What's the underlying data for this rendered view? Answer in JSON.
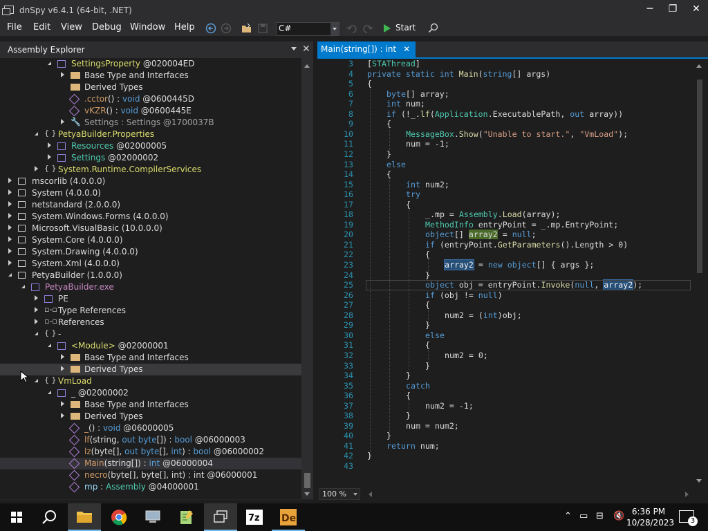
{
  "window": {
    "title": "dnSpy v6.4.1 (64-bit, .NET)"
  },
  "menu": [
    "File",
    "Edit",
    "View",
    "Debug",
    "Window",
    "Help"
  ],
  "toolbar": {
    "language": "C#",
    "start_label": "Start"
  },
  "explorer": {
    "title": "Assembly Explorer",
    "rows": [
      {
        "d": 3,
        "exp": "ef",
        "ico": "cls",
        "parts": [
          [
            "SettingsProperty",
            "cy"
          ],
          [
            " @020004ED",
            "cw"
          ]
        ]
      },
      {
        "d": 4,
        "exp": "c",
        "ico": "folder",
        "parts": [
          [
            "Base Type and Interfaces",
            "cw"
          ]
        ]
      },
      {
        "d": 4,
        "exp": "",
        "ico": "folder",
        "parts": [
          [
            "Derived Types",
            "cw"
          ]
        ]
      },
      {
        "d": 4,
        "exp": "",
        "ico": "meth",
        "parts": [
          [
            ".cctor",
            "co"
          ],
          [
            "() : ",
            "cw"
          ],
          [
            "void",
            "cb"
          ],
          [
            " @0600445D",
            "cw"
          ]
        ]
      },
      {
        "d": 4,
        "exp": "",
        "ico": "meth",
        "parts": [
          [
            "vKZR",
            "co"
          ],
          [
            "() : ",
            "cw"
          ],
          [
            "void",
            "cb"
          ],
          [
            " @0600445E",
            "cw"
          ]
        ]
      },
      {
        "d": 4,
        "exp": "c",
        "ico": "prop",
        "parts": [
          [
            "Settings",
            "cgr"
          ],
          [
            " : ",
            "cgr"
          ],
          [
            "Settings",
            "cgr"
          ],
          [
            " @1700037B",
            "cgr"
          ]
        ]
      },
      {
        "d": 2,
        "exp": "ef",
        "ico": "ns",
        "parts": [
          [
            "PetyaBuilder.Properties",
            "cy"
          ]
        ]
      },
      {
        "d": 3,
        "exp": "c",
        "ico": "cls",
        "parts": [
          [
            "Resources",
            "cc"
          ],
          [
            " @02000005",
            "cw"
          ]
        ]
      },
      {
        "d": 3,
        "exp": "c",
        "ico": "cls",
        "parts": [
          [
            "Settings",
            "cc"
          ],
          [
            " @02000002",
            "cw"
          ]
        ]
      },
      {
        "d": 2,
        "exp": "c",
        "ico": "ns",
        "parts": [
          [
            "System.Runtime.CompilerServices",
            "cy"
          ]
        ]
      },
      {
        "d": 0,
        "exp": "c",
        "ico": "asm",
        "parts": [
          [
            "mscorlib (4.0.0.0)",
            "cw"
          ]
        ]
      },
      {
        "d": 0,
        "exp": "c",
        "ico": "asm",
        "parts": [
          [
            "System (4.0.0.0)",
            "cw"
          ]
        ]
      },
      {
        "d": 0,
        "exp": "c",
        "ico": "asm",
        "parts": [
          [
            "netstandard (2.0.0.0)",
            "cw"
          ]
        ]
      },
      {
        "d": 0,
        "exp": "c",
        "ico": "asm",
        "parts": [
          [
            "System.Windows.Forms (4.0.0.0)",
            "cw"
          ]
        ]
      },
      {
        "d": 0,
        "exp": "c",
        "ico": "asm",
        "parts": [
          [
            "Microsoft.VisualBasic (10.0.0.0)",
            "cw"
          ]
        ]
      },
      {
        "d": 0,
        "exp": "c",
        "ico": "asm",
        "parts": [
          [
            "System.Core (4.0.0.0)",
            "cw"
          ]
        ]
      },
      {
        "d": 0,
        "exp": "c",
        "ico": "asm",
        "parts": [
          [
            "System.Drawing (4.0.0.0)",
            "cw"
          ]
        ]
      },
      {
        "d": 0,
        "exp": "c",
        "ico": "asm",
        "parts": [
          [
            "System.Xml (4.0.0.0)",
            "cw"
          ]
        ]
      },
      {
        "d": 0,
        "exp": "ef",
        "ico": "asm",
        "parts": [
          [
            "PetyaBuilder (1.0.0.0)",
            "cw"
          ]
        ]
      },
      {
        "d": 1,
        "exp": "ef",
        "ico": "cls",
        "parts": [
          [
            "PetyaBuilder.exe",
            "cv"
          ]
        ]
      },
      {
        "d": 2,
        "exp": "c",
        "ico": "cls",
        "parts": [
          [
            "PE",
            "cw"
          ]
        ]
      },
      {
        "d": 2,
        "exp": "c",
        "ico": "ref",
        "parts": [
          [
            "Type References",
            "cw"
          ]
        ]
      },
      {
        "d": 2,
        "exp": "c",
        "ico": "ref",
        "parts": [
          [
            "References",
            "cw"
          ]
        ]
      },
      {
        "d": 2,
        "exp": "ef",
        "ico": "ns",
        "parts": [
          [
            "-",
            "cw"
          ]
        ]
      },
      {
        "d": 3,
        "exp": "ef",
        "ico": "cls",
        "parts": [
          [
            "<Module>",
            "cy"
          ],
          [
            " @02000001",
            "cw"
          ]
        ]
      },
      {
        "d": 4,
        "exp": "c",
        "ico": "folder",
        "parts": [
          [
            "Base Type and Interfaces",
            "cw"
          ]
        ]
      },
      {
        "d": 4,
        "exp": "c",
        "ico": "folder",
        "parts": [
          [
            "Derived Types",
            "cw"
          ]
        ],
        "sel": true
      },
      {
        "d": 2,
        "exp": "ef",
        "ico": "ns",
        "parts": [
          [
            "VmLoad",
            "cy"
          ]
        ]
      },
      {
        "d": 3,
        "exp": "ef",
        "ico": "cls",
        "parts": [
          [
            "_",
            "cw"
          ],
          [
            " @02000002",
            "cw"
          ]
        ]
      },
      {
        "d": 4,
        "exp": "c",
        "ico": "folder",
        "parts": [
          [
            "Base Type and Interfaces",
            "cw"
          ]
        ]
      },
      {
        "d": 4,
        "exp": "c",
        "ico": "folder",
        "parts": [
          [
            "Derived Types",
            "cw"
          ]
        ]
      },
      {
        "d": 4,
        "exp": "",
        "ico": "meth",
        "parts": [
          [
            "_",
            "co"
          ],
          [
            "() : ",
            "cw"
          ],
          [
            "void",
            "cb"
          ],
          [
            " @06000005",
            "cw"
          ]
        ]
      },
      {
        "d": 4,
        "exp": "",
        "ico": "meth",
        "parts": [
          [
            "lf",
            "co"
          ],
          [
            "(string, ",
            "cw"
          ],
          [
            "out byte",
            "cb"
          ],
          [
            "[]) : ",
            "cw"
          ],
          [
            "bool",
            "cb"
          ],
          [
            " @06000003",
            "cw"
          ]
        ]
      },
      {
        "d": 4,
        "exp": "",
        "ico": "meth",
        "parts": [
          [
            "lz",
            "co"
          ],
          [
            "(byte[], ",
            "cw"
          ],
          [
            "out byte",
            "cb"
          ],
          [
            "[], ",
            "cw"
          ],
          [
            "int",
            "cb"
          ],
          [
            ") : ",
            "cw"
          ],
          [
            "bool",
            "cb"
          ],
          [
            " @06000002",
            "cw"
          ]
        ]
      },
      {
        "d": 4,
        "exp": "",
        "ico": "meth",
        "parts": [
          [
            "Main",
            "co"
          ],
          [
            "(string[]) : ",
            "cw"
          ],
          [
            "int",
            "cb"
          ],
          [
            " @06000004",
            "cw"
          ]
        ],
        "hl": true
      },
      {
        "d": 4,
        "exp": "",
        "ico": "meth",
        "parts": [
          [
            "necro",
            "co"
          ],
          [
            "(byte[], byte[], int) : int @06000001",
            "cw"
          ]
        ]
      },
      {
        "d": 4,
        "exp": "",
        "ico": "meth",
        "parts": [
          [
            "mp",
            "cg"
          ],
          [
            " : ",
            "cw"
          ],
          [
            "Assembly",
            "cc"
          ],
          [
            " @04000001",
            "cw"
          ]
        ]
      }
    ]
  },
  "editor": {
    "tab_label": "Main(string[]) : int",
    "zoom": "100 %",
    "lines": [
      {
        "n": "3",
        "y": 0,
        "i": 0,
        "c": [
          [
            "[",
            "p"
          ],
          [
            "STAThread",
            "t"
          ],
          [
            "]",
            "p"
          ]
        ]
      },
      {
        "n": "4",
        "y": 1,
        "i": 0,
        "c": [
          [
            "private static int ",
            "k"
          ],
          [
            "Main",
            "m"
          ],
          [
            "(",
            "p"
          ],
          [
            "string",
            "k"
          ],
          [
            "[] args)",
            "p"
          ]
        ]
      },
      {
        "n": "5",
        "y": 2,
        "i": 0,
        "c": [
          [
            "{",
            "p"
          ]
        ]
      },
      {
        "n": "6",
        "y": 3,
        "i": 1,
        "c": [
          [
            "byte",
            "k"
          ],
          [
            "[] array;",
            "p"
          ]
        ]
      },
      {
        "n": "7",
        "y": 4,
        "i": 1,
        "c": [
          [
            "int",
            "k"
          ],
          [
            " num;",
            "p"
          ]
        ]
      },
      {
        "n": "8",
        "y": 5,
        "i": 1,
        "c": [
          [
            "if",
            "k"
          ],
          [
            " (!_.",
            "p"
          ],
          [
            "lf",
            "m"
          ],
          [
            "(",
            "p"
          ],
          [
            "Application",
            "t"
          ],
          [
            ".",
            "p"
          ],
          [
            "ExecutablePath",
            "pr"
          ],
          [
            ", ",
            "p"
          ],
          [
            "out",
            "k"
          ],
          [
            " array))",
            "p"
          ]
        ]
      },
      {
        "n": "9",
        "y": 6,
        "i": 1,
        "c": [
          [
            "{",
            "p"
          ]
        ]
      },
      {
        "n": "10",
        "y": 7,
        "i": 2,
        "c": [
          [
            "MessageBox",
            "t"
          ],
          [
            ".",
            "p"
          ],
          [
            "Show",
            "m"
          ],
          [
            "(",
            "p"
          ],
          [
            "\"Unable to start.\"",
            "s"
          ],
          [
            ", ",
            "p"
          ],
          [
            "\"VmLoad\"",
            "s"
          ],
          [
            ");",
            "p"
          ]
        ]
      },
      {
        "n": "11",
        "y": 8,
        "i": 2,
        "c": [
          [
            "num = -1;",
            "p"
          ]
        ]
      },
      {
        "n": "12",
        "y": 9,
        "i": 1,
        "c": [
          [
            "}",
            "p"
          ]
        ]
      },
      {
        "n": "13",
        "y": 10,
        "i": 1,
        "c": [
          [
            "else",
            "k"
          ]
        ]
      },
      {
        "n": "14",
        "y": 11,
        "i": 1,
        "c": [
          [
            "{",
            "p"
          ]
        ]
      },
      {
        "n": "15",
        "y": 12,
        "i": 2,
        "c": [
          [
            "int",
            "k"
          ],
          [
            " num2;",
            "p"
          ]
        ]
      },
      {
        "n": "16",
        "y": 13,
        "i": 2,
        "c": [
          [
            "try",
            "k"
          ]
        ]
      },
      {
        "n": "17",
        "y": 14,
        "i": 2,
        "c": [
          [
            "{",
            "p"
          ]
        ]
      },
      {
        "n": "18",
        "y": 15,
        "i": 3,
        "c": [
          [
            "_.",
            "p"
          ],
          [
            "mp",
            "v"
          ],
          [
            " = ",
            "p"
          ],
          [
            "Assembly",
            "t"
          ],
          [
            ".",
            "p"
          ],
          [
            "Load",
            "m"
          ],
          [
            "(array);",
            "p"
          ]
        ]
      },
      {
        "n": "19",
        "y": 16,
        "i": 3,
        "c": [
          [
            "MethodInfo",
            "t"
          ],
          [
            " entryPoint = _.",
            "p"
          ],
          [
            "mp",
            "v"
          ],
          [
            ".",
            "p"
          ],
          [
            "EntryPoint",
            "pr"
          ],
          [
            ";",
            "p"
          ]
        ]
      },
      {
        "n": "20",
        "y": 17,
        "i": 3,
        "c": [
          [
            "object",
            "k"
          ],
          [
            "[] ",
            "p"
          ],
          [
            "array2",
            "hlg"
          ],
          [
            " = ",
            "p"
          ],
          [
            "null",
            "k"
          ],
          [
            ";",
            "p"
          ]
        ]
      },
      {
        "n": "21",
        "y": 18,
        "i": 3,
        "c": [
          [
            "if",
            "k"
          ],
          [
            " (entryPoint.",
            "p"
          ],
          [
            "GetParameters",
            "m"
          ],
          [
            "().",
            "p"
          ],
          [
            "Length",
            "pr"
          ],
          [
            " > 0)",
            "p"
          ]
        ]
      },
      {
        "n": "22",
        "y": 19,
        "i": 3,
        "c": [
          [
            "{",
            "p"
          ]
        ]
      },
      {
        "n": "23",
        "y": 20,
        "i": 4,
        "c": [
          [
            "array2",
            "mk"
          ],
          [
            " = ",
            "p"
          ],
          [
            "new object",
            "k"
          ],
          [
            "[] { args };",
            "p"
          ]
        ]
      },
      {
        "n": "24",
        "y": 21,
        "i": 3,
        "c": [
          [
            "}",
            "p"
          ]
        ]
      },
      {
        "n": "25",
        "y": 22,
        "i": 3,
        "cur": true,
        "c": [
          [
            "object",
            "k"
          ],
          [
            " obj = entryPoint.",
            "p"
          ],
          [
            "Invoke",
            "m"
          ],
          [
            "(",
            "p"
          ],
          [
            "null",
            "k"
          ],
          [
            ", ",
            "p"
          ],
          [
            "array2",
            "mk"
          ],
          [
            ");",
            "p"
          ]
        ]
      },
      {
        "n": "26",
        "y": 23,
        "i": 3,
        "c": [
          [
            "if",
            "k"
          ],
          [
            " (obj != ",
            "p"
          ],
          [
            "null",
            "k"
          ],
          [
            ")",
            "p"
          ]
        ]
      },
      {
        "n": "27",
        "y": 24,
        "i": 3,
        "c": [
          [
            "{",
            "p"
          ]
        ]
      },
      {
        "n": "28",
        "y": 25,
        "i": 4,
        "c": [
          [
            "num2 = (",
            "p"
          ],
          [
            "int",
            "k"
          ],
          [
            ")obj;",
            "p"
          ]
        ]
      },
      {
        "n": "29",
        "y": 26,
        "i": 3,
        "c": [
          [
            "}",
            "p"
          ]
        ]
      },
      {
        "n": "30",
        "y": 27,
        "i": 3,
        "c": [
          [
            "else",
            "k"
          ]
        ]
      },
      {
        "n": "31",
        "y": 28,
        "i": 3,
        "c": [
          [
            "{",
            "p"
          ]
        ]
      },
      {
        "n": "32",
        "y": 29,
        "i": 4,
        "c": [
          [
            "num2 = 0;",
            "p"
          ]
        ]
      },
      {
        "n": "33",
        "y": 30,
        "i": 3,
        "c": [
          [
            "}",
            "p"
          ]
        ]
      },
      {
        "n": "34",
        "y": 31,
        "i": 2,
        "c": [
          [
            "}",
            "p"
          ]
        ]
      },
      {
        "n": "35",
        "y": 32,
        "i": 2,
        "c": [
          [
            "catch",
            "k"
          ]
        ]
      },
      {
        "n": "36",
        "y": 33,
        "i": 2,
        "c": [
          [
            "{",
            "p"
          ]
        ]
      },
      {
        "n": "37",
        "y": 34,
        "i": 3,
        "c": [
          [
            "num2 = -1;",
            "p"
          ]
        ]
      },
      {
        "n": "38",
        "y": 35,
        "i": 2,
        "c": [
          [
            "}",
            "p"
          ]
        ]
      },
      {
        "n": "39",
        "y": 36,
        "i": 2,
        "c": [
          [
            "num = num2;",
            "p"
          ]
        ]
      },
      {
        "n": "40",
        "y": 37,
        "i": 1,
        "c": [
          [
            "}",
            "p"
          ]
        ]
      },
      {
        "n": "41",
        "y": 38,
        "i": 1,
        "c": [
          [
            "return",
            "k"
          ],
          [
            " num;",
            "p"
          ]
        ]
      },
      {
        "n": "42",
        "y": 39,
        "i": 0,
        "c": [
          [
            "}",
            "p"
          ]
        ]
      },
      {
        "n": "43",
        "y": 40,
        "i": 0,
        "c": []
      }
    ]
  },
  "taskbar": {
    "time": "6:36 PM",
    "date": "10/28/2023",
    "notifications": "3",
    "apps": [
      "search-icon",
      "file-explorer-icon",
      "chrome-icon",
      "computer-icon",
      "notepad-icon",
      "dnspy-icon",
      "7zip-icon",
      "detect-it-easy-icon"
    ]
  }
}
